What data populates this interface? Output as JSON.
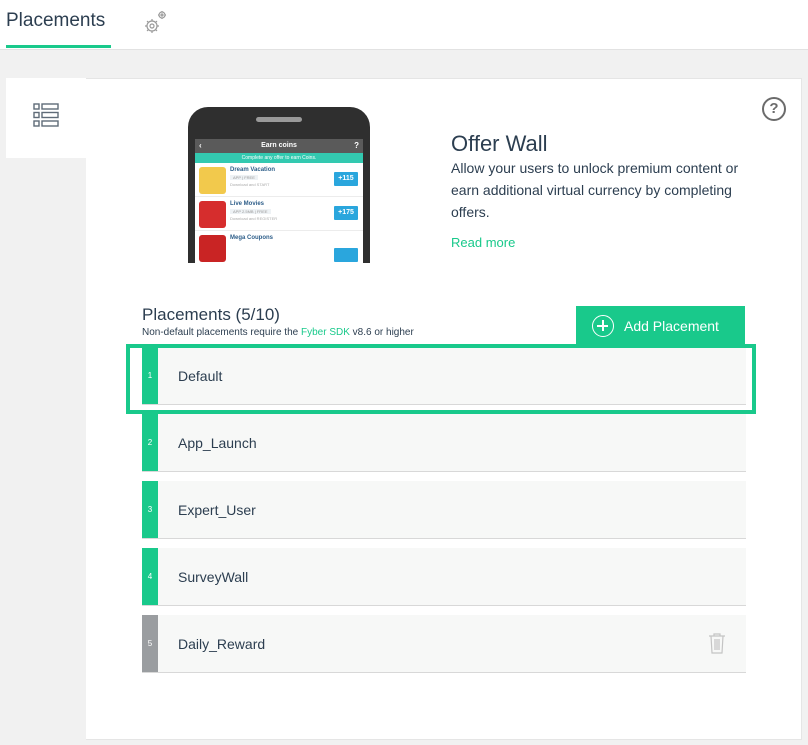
{
  "header": {
    "tab_label": "Placements",
    "settings_icon": "gear-icon"
  },
  "sidebar": {
    "list_icon": "list-icon"
  },
  "help": {
    "label": "?"
  },
  "preview": {
    "header_title": "Earn coins",
    "back": "‹",
    "help": "?",
    "banner": "Complete any offer to earn Coins.",
    "offers": [
      {
        "title": "Dream Vacation",
        "tag": "APP | FREE",
        "desc": "Download and START",
        "points": "+115",
        "color": "#f2c94c"
      },
      {
        "title": "Live Movies",
        "tag": "APP 2.5MB | FREE",
        "desc": "Download and REGISTER",
        "points": "+175",
        "color": "#d62d2d"
      },
      {
        "title": "Mega Coupons",
        "tag": "",
        "desc": "",
        "points": "",
        "color": "#c92424"
      }
    ]
  },
  "offerwall": {
    "title": "Offer Wall",
    "description": "Allow your users to unlock premium content or earn additional virtual currency by completing offers.",
    "read_more": "Read more"
  },
  "placements": {
    "title": "Placements (5/10)",
    "note_prefix": "Non-default placements require the ",
    "note_link": "Fyber SDK",
    "note_suffix": " v8.6 or higher",
    "add_button": "Add Placement",
    "rows": [
      {
        "number": "1",
        "name": "Default"
      },
      {
        "number": "2",
        "name": "App_Launch"
      },
      {
        "number": "3",
        "name": "Expert_User"
      },
      {
        "number": "4",
        "name": "SurveyWall"
      },
      {
        "number": "5",
        "name": "Daily_Reward"
      }
    ]
  },
  "colors": {
    "accent": "#19c98b",
    "text": "#2c3e50",
    "disabled_number": "#9a9da0"
  }
}
